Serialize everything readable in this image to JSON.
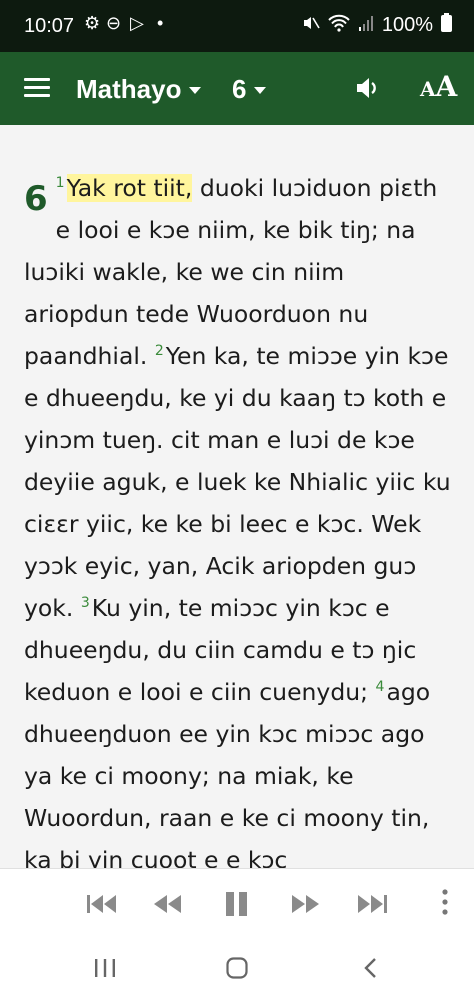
{
  "status_bar": {
    "time": "10:07",
    "battery": "100%"
  },
  "app_bar": {
    "book": "Mathayo",
    "chapter": "6"
  },
  "reader": {
    "chapter_number": "6",
    "v1_num": "1",
    "v1_highlight": "Yak rot tiit,",
    "v1_rest": " duoki luɔiduon piɛth e looi e kɔe niim, ke bik tiŋ; na luɔiki wakle, ke we cin niim ariopdun tede Wuoorduon nu paandhial. ",
    "v2_num": "2",
    "v2_text": "Yen ka, te miɔɔe yin kɔe e dhueeŋdu, ke yi du kaaŋ tɔ koth e yinɔm tueŋ. cit man e luɔi de kɔe deyiie aguk, e luek ke Nhialic yiic ku ciɛɛr yiic, ke ke bi leec e kɔc. Wek yɔɔk eyic, yan, Acik ariopden guɔ yok. ",
    "v3_num": "3",
    "v3_text": "Ku yin, te miɔɔc yin kɔc e dhueeŋdu, du ciin camdu e tɔ ŋic keduon e looi e ciin cuenydu; ",
    "v4_num": "4",
    "v4_text": "ago dhueeŋduon ee yin kɔc miɔɔc ago ya ke ci moony; na miak, ke Wuoordun, raan e ke ci moony tin, ka bi yin cuoot e e kɔc"
  }
}
